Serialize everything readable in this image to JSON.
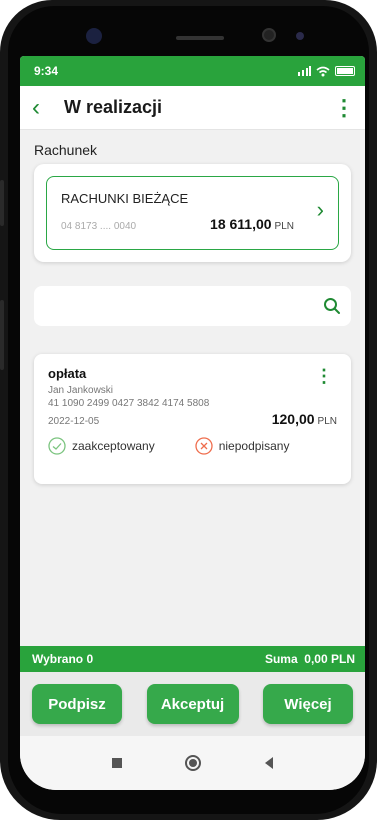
{
  "status": {
    "time": "9:34"
  },
  "header": {
    "title": "W realizacji"
  },
  "section_label": "Rachunek",
  "account": {
    "name": "RACHUNKI BIEŻĄCE",
    "number": "04 8173 .... 0040",
    "balance": "18 611,00",
    "currency": "PLN"
  },
  "search": {
    "placeholder": ""
  },
  "transaction": {
    "title": "opłata",
    "recipient": "Jan Jankowski",
    "account_number": "41 1090 2499 0427 3842 4174 5808",
    "date": "2022-12-05",
    "amount": "120,00",
    "currency": "PLN",
    "status_accepted": "zaakceptowany",
    "status_signed": "niepodpisany"
  },
  "summary": {
    "selected": "Wybrano 0",
    "sum_label": "Suma",
    "sum_value": "0,00 PLN"
  },
  "actions": {
    "sign": "Podpisz",
    "accept": "Akceptuj",
    "more": "Więcej"
  },
  "colors": {
    "brand_green": "#29a33c",
    "button_green": "#36a94b",
    "reject_orange": "#ef6d4d"
  }
}
